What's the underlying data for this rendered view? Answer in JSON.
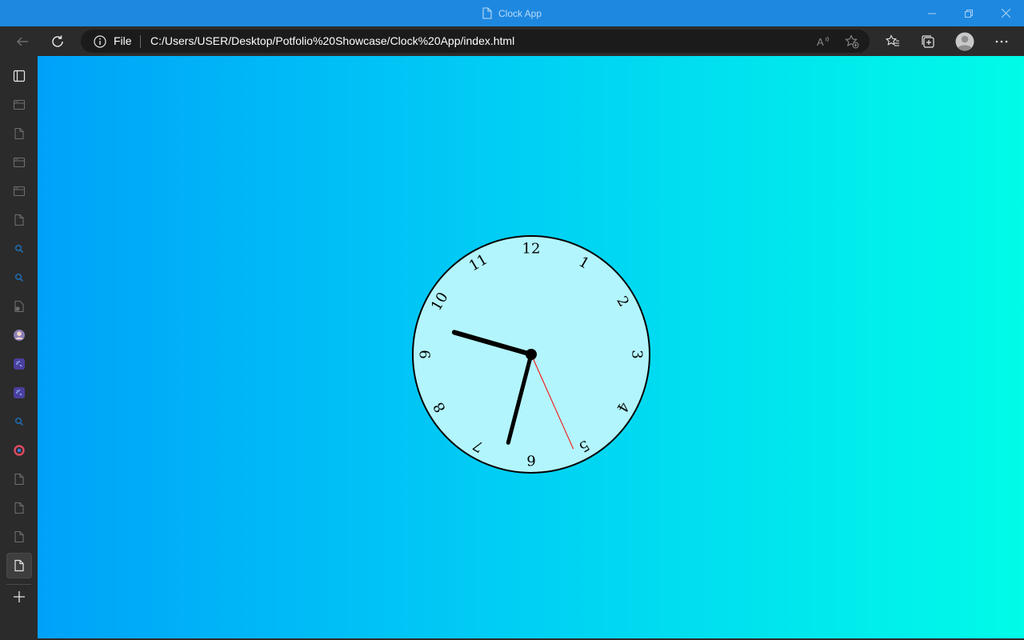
{
  "window": {
    "title": "Clock App",
    "titlebar_color": "#1e88e0"
  },
  "toolbar": {
    "back_icon": "back-arrow-icon",
    "refresh_icon": "refresh-icon",
    "address": {
      "scheme_label": "File",
      "url": "C:/Users/USER/Desktop/Potfolio%20Showcase/Clock%20App/index.html"
    },
    "right_icons": [
      "read-aloud-icon",
      "add-favorite-icon",
      "favorites-icon",
      "collections-icon",
      "profile-icon",
      "more-icon"
    ]
  },
  "sidebar": {
    "tabs": [
      {
        "icon": "tab-actions-icon"
      },
      {
        "icon": "page-tab-icon"
      },
      {
        "icon": "document-tab-icon"
      },
      {
        "icon": "page-tab-icon"
      },
      {
        "icon": "page-tab-icon"
      },
      {
        "icon": "document-tab-icon"
      },
      {
        "icon": "search-tab-icon"
      },
      {
        "icon": "search-tab-icon"
      },
      {
        "icon": "file-tab-icon"
      },
      {
        "icon": "avatar-tab-icon"
      },
      {
        "icon": "app-tab-icon"
      },
      {
        "icon": "app-tab-icon"
      },
      {
        "icon": "search-tab-icon"
      },
      {
        "icon": "colorful-tab-icon"
      },
      {
        "icon": "document-tab-icon"
      },
      {
        "icon": "document-tab-icon"
      },
      {
        "icon": "document-tab-icon"
      },
      {
        "icon": "document-tab-icon",
        "active": true
      }
    ],
    "new_tab_icon": "plus-icon"
  },
  "page": {
    "background_colors": [
      "#00a2f9",
      "#00fbe8"
    ],
    "clock": {
      "face_color": "#b3f5fc",
      "numbers": [
        "12",
        "1",
        "2",
        "3",
        "4",
        "5",
        "6",
        "7",
        "8",
        "9",
        "10",
        "11"
      ],
      "time": {
        "hour": 9,
        "minute": 32,
        "second": 26
      },
      "second_hand_color": "#ff0000"
    }
  }
}
